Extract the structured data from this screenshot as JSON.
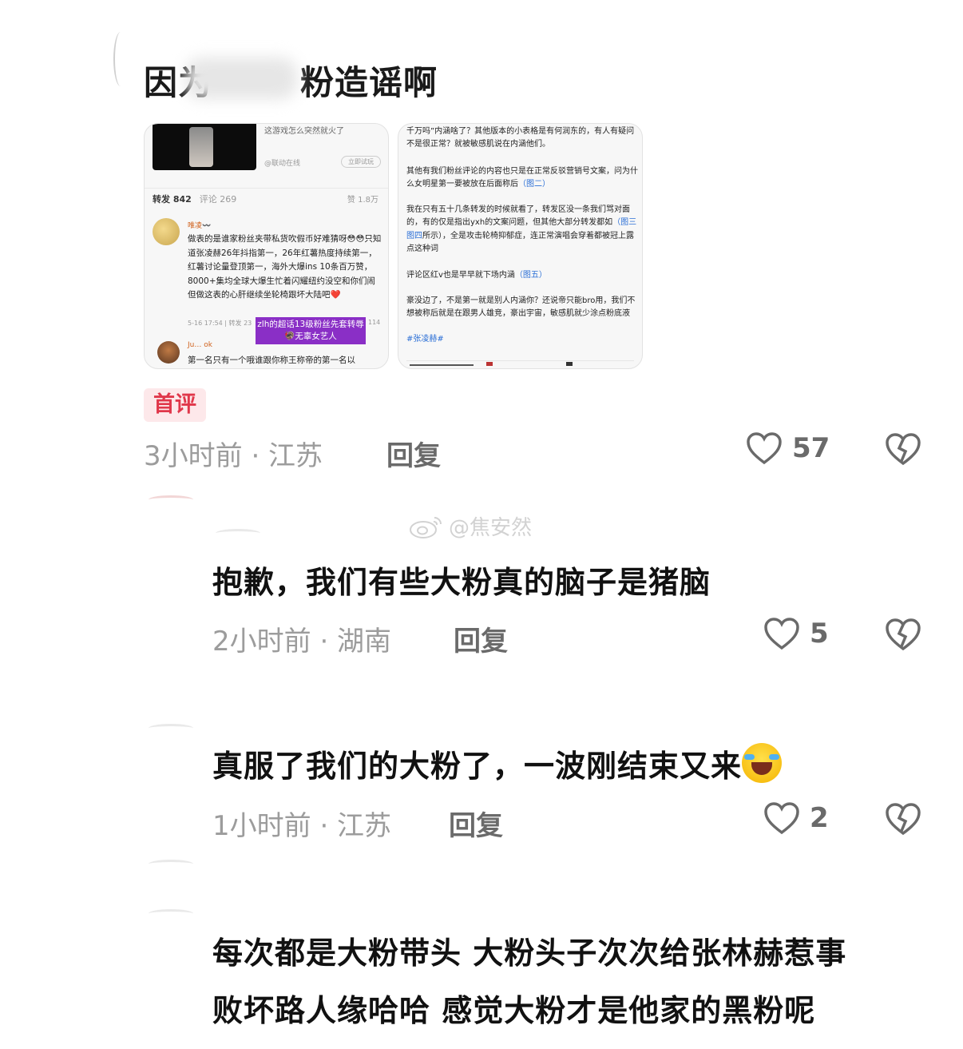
{
  "post": {
    "title": "因为大粉造谣啊",
    "title_visible_start": "因为",
    "title_visible_end": "粉造谣啊",
    "first_badge": "首评",
    "time_location": "3小时前 · 江苏",
    "reply_label": "回复",
    "likes": "57"
  },
  "screenshot1": {
    "video_title": "这游戏怎么突然就火了",
    "source": "@联动在线",
    "try_play": "立即试玩",
    "reposts_label": "转发 842",
    "comments_label": "评论 269",
    "likes_label": "赞 1.8万",
    "username": "唯凌〰️",
    "body": "做表的是谁家粉丝夹带私货吹假币好难猜呀😳😳只知道张凌赫26年抖指第一，26年红薯热度持续第一，红薯讨论量登顶第一，海外大爆ins 10条百万赞，8000+集均全球大爆生忙着闪耀纽约没空和你们闹但做这表的心肝继续坐轮椅跟坏大陆吧❤️",
    "meta_left": "5-16 17:54 | 转发 23",
    "meta_right": "114",
    "caption": "zlh的超话13级粉丝先套转辱🦃无辜女艺人",
    "username2": "Ju… ok",
    "reply2": "第一名只有一个哦谁跟你称王称帝的第一名以"
  },
  "screenshot2": {
    "p1": "千万吗”内涵啥了？其他版本的小表格是有何润东的，有人有疑问不是很正常？就被敏感肌说在内涵他们。",
    "p2_text": "其他有我们粉丝评论的内容也只是在正常反驳营销号文案，问为什么女明星第一要被放在后面称后",
    "p2_link": "（图二）",
    "p3_text": "我在只有五十几条转发的时候就看了，转发区没一条我们骂对面的，有的仅是指出yxh的文案问题，但其他大部分转发都如",
    "p3_link": "（图三图四",
    "p3_tail": "所示），全是攻击轮椅抑郁症，连正常演唱会穿着都被冠上露点这种词",
    "p4_text": "评论区红v也是早早就下场内涵",
    "p4_link": "（图五）",
    "p5": "豪没边了，不是第一就是别人内涵你？还说帝只能bro用，我们不想被称后就是在跟男人雄竞，豪出宇宙，敏感肌就少涂点粉底液",
    "hashtag": "#张凌赫#"
  },
  "watermark": "@焦安然",
  "comments": [
    {
      "text": "抱歉，我们有些大粉真的脑子是猪脑",
      "time_location": "2小时前 · 湖南",
      "reply_label": "回复",
      "likes": "5"
    },
    {
      "text": "真服了我们的大粉了，一波刚结束又来",
      "emoji": "crying-laughing-face",
      "time_location": "1小时前 · 江苏",
      "reply_label": "回复",
      "likes": "2"
    },
    {
      "text_line1": "每次都是大粉带头 大粉头子次次给张林赫惹事",
      "text_line2": "败坏路人缘哈哈 感觉大粉才是他家的黑粉呢"
    }
  ],
  "colors": {
    "badge_bg": "#fde8ea",
    "badge_text": "#e0374a",
    "meta_gray": "#9c9c9c",
    "caption_purple": "#8a2fc6"
  }
}
